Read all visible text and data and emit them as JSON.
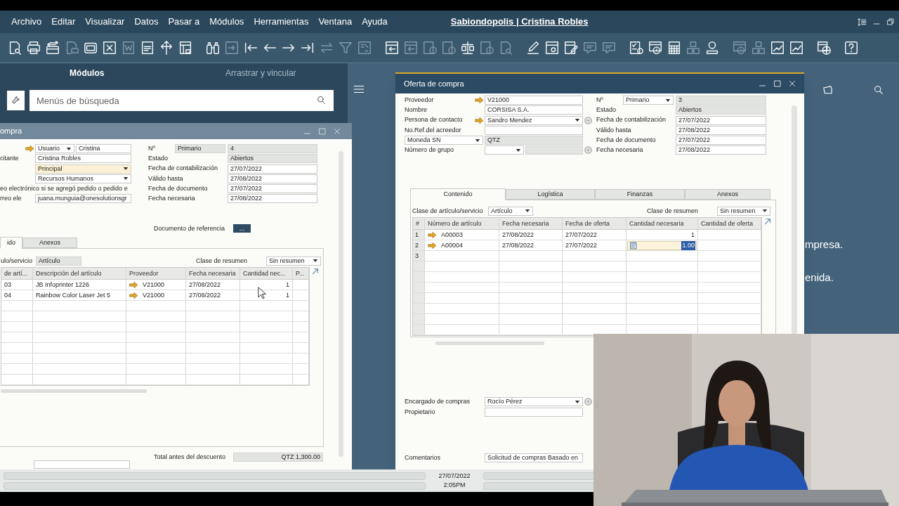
{
  "menu_bar": {
    "items": [
      "Archivo",
      "Editar",
      "Visualizar",
      "Datos",
      "Pasar a",
      "Módulos",
      "Herramientas",
      "Ventana",
      "Ayuda"
    ],
    "title": "Sabiondopolis | Cristina Robles"
  },
  "toolbar": {
    "groups": [
      {
        "buttons": [
          {
            "kind": "doc-search",
            "disabled": false
          },
          {
            "kind": "printer",
            "disabled": false
          },
          {
            "kind": "card",
            "disabled": false
          },
          {
            "kind": "doc-chat",
            "disabled": true
          },
          {
            "kind": "windows",
            "disabled": false
          },
          {
            "kind": "x-box",
            "disabled": false
          },
          {
            "kind": "word-doc",
            "disabled": true
          },
          {
            "kind": "pdf-doc",
            "disabled": false
          },
          {
            "kind": "move",
            "disabled": false
          },
          {
            "kind": "doc-lock",
            "disabled": false
          }
        ]
      },
      {
        "buttons": [
          {
            "kind": "binoculars",
            "disabled": false
          },
          {
            "kind": "import",
            "disabled": true
          },
          {
            "kind": "first",
            "disabled": false
          },
          {
            "kind": "prev",
            "disabled": false
          },
          {
            "kind": "next",
            "disabled": false
          },
          {
            "kind": "last",
            "disabled": false
          },
          {
            "kind": "swap",
            "disabled": true
          },
          {
            "kind": "filter",
            "disabled": true
          },
          {
            "kind": "sort",
            "disabled": true
          }
        ]
      },
      {
        "buttons": [
          {
            "kind": "doc-arrow",
            "disabled": false
          },
          {
            "kind": "doc-arrow",
            "disabled": true
          },
          {
            "kind": "doc-coin",
            "disabled": true
          },
          {
            "kind": "doc-coin",
            "disabled": true
          },
          {
            "kind": "scale",
            "disabled": false
          },
          {
            "kind": "doc-coin",
            "disabled": true
          },
          {
            "kind": "doc-search",
            "disabled": true
          }
        ]
      },
      {
        "buttons": [
          {
            "kind": "pencil",
            "disabled": false
          },
          {
            "kind": "gear-window",
            "disabled": false
          },
          {
            "kind": "pencil-doc",
            "disabled": false
          },
          {
            "kind": "chat",
            "disabled": true
          },
          {
            "kind": "chat",
            "disabled": true
          }
        ]
      },
      {
        "buttons": [
          {
            "kind": "checklist",
            "disabled": false
          },
          {
            "kind": "alert-window",
            "disabled": false
          },
          {
            "kind": "calculator",
            "disabled": false
          },
          {
            "kind": "boxes",
            "disabled": true
          },
          {
            "kind": "user",
            "disabled": false
          }
        ]
      },
      {
        "buttons": [
          {
            "kind": "alert-window",
            "disabled": true
          },
          {
            "kind": "boxes",
            "disabled": true
          },
          {
            "kind": "chart",
            "disabled": false
          },
          {
            "kind": "chart",
            "disabled": false
          }
        ]
      },
      {
        "buttons": [
          {
            "kind": "globe",
            "disabled": false
          }
        ]
      },
      {
        "buttons": [
          {
            "kind": "help",
            "disabled": false
          }
        ]
      }
    ]
  },
  "left_panel": {
    "tabs": [
      {
        "label": "Módulos",
        "selected": true
      },
      {
        "label": "Arrastrar y vincular",
        "selected": false
      }
    ],
    "search": {
      "placeholder": "Menús de búsqueda"
    }
  },
  "desktop_notes": [
    "mpresa.",
    "enida."
  ],
  "request_window": {
    "title": "ompra",
    "left_rows": [
      {
        "kind": "field",
        "link": true,
        "fields": [
          {
            "value": "Usuario",
            "dropdown": true,
            "readonly": false,
            "highlight": false
          },
          {
            "value": "Cristina",
            "dropdown": false,
            "readonly": false,
            "highlight": false
          }
        ]
      },
      {
        "kind": "field",
        "label": "citante",
        "link": false,
        "fields": [
          {
            "value": "Cristina Robles",
            "dropdown": false,
            "readonly": false,
            "highlight": false
          }
        ]
      },
      {
        "kind": "field",
        "link": false,
        "fields": [
          {
            "value": "Principal",
            "dropdown": true,
            "readonly": false,
            "highlight": true
          }
        ]
      },
      {
        "kind": "field",
        "link": false,
        "fields": [
          {
            "value": "Recursos Humanos",
            "dropdown": true,
            "readonly": false,
            "highlight": false
          }
        ]
      },
      {
        "kind": "wide_label",
        "label": "eo electrónico si se agregó pedido o pedido e",
        "link": false
      },
      {
        "kind": "field",
        "label": "rreo ele",
        "link": false,
        "fields": [
          {
            "value": "juana.munguia@onesolutionsgr",
            "dropdown": false,
            "readonly": false,
            "highlight": false
          }
        ]
      }
    ],
    "right_rows": [
      {
        "kind": "split",
        "label": "Nº",
        "fields": [
          {
            "value": "Primario",
            "dropdown": false,
            "readonly": true,
            "highlight": false
          },
          {
            "value": "4",
            "dropdown": false,
            "readonly": true,
            "highlight": false
          }
        ]
      },
      {
        "kind": "field",
        "label": "Estado",
        "fields": [
          {
            "value": "Abiertos",
            "dropdown": false,
            "readonly": true,
            "highlight": false
          }
        ]
      },
      {
        "kind": "field",
        "label": "Fecha de contabilización",
        "fields": [
          {
            "value": "27/07/2022",
            "dropdown": false,
            "readonly": false,
            "highlight": false
          }
        ]
      },
      {
        "kind": "field",
        "label": "Válido hasta",
        "fields": [
          {
            "value": "27/08/2022",
            "dropdown": false,
            "readonly": false,
            "highlight": false
          }
        ]
      },
      {
        "kind": "field",
        "label": "Fecha de documento",
        "fields": [
          {
            "value": "27/07/2022",
            "dropdown": false,
            "readonly": false,
            "highlight": false
          }
        ]
      },
      {
        "kind": "field",
        "label": "Fecha necesaria",
        "fields": [
          {
            "value": "27/08/2022",
            "dropdown": false,
            "readonly": false,
            "highlight": false
          }
        ]
      }
    ],
    "reference": {
      "label": "Documento de referencia",
      "button": "..."
    },
    "tabs": [
      {
        "label": "ido",
        "selected": true
      },
      {
        "label": "Anexos",
        "selected": false
      }
    ],
    "item_type": {
      "label": "ulo/servicio",
      "field": {
        "value": "Artículo",
        "dropdown": false,
        "readonly": true,
        "highlight": false
      }
    },
    "summary": {
      "label": "Clase de resumen",
      "field": {
        "value": "Sin resumen",
        "dropdown": true,
        "readonly": false,
        "highlight": false
      }
    },
    "grid": {
      "columns": [
        {
          "header": "de artí...",
          "kind": "text"
        },
        {
          "header": "Descripción del artículo",
          "kind": "text"
        },
        {
          "header": "Proveedor",
          "kind": "link"
        },
        {
          "header": "Fecha necesaria",
          "kind": "text"
        },
        {
          "header": "Cantidad nec...",
          "kind": "number"
        },
        {
          "header": "P...",
          "kind": "text"
        }
      ],
      "rows": [
        {
          "cells": [
            "03",
            "JB Infoprinter 1226",
            "V21000",
            "27/08/2022",
            "1"
          ],
          "editing": false
        },
        {
          "cells": [
            "04",
            "Rainbow Color Laser Jet 5",
            "V21000",
            "27/08/2022",
            "1"
          ],
          "editing": false
        }
      ]
    },
    "total": {
      "label": "Total antes del descuento",
      "value": "QTZ 1,300.00"
    }
  },
  "offer_window": {
    "title": "Oferta de compra",
    "left_rows": [
      {
        "kind": "field",
        "label": "Proveedor",
        "link": true,
        "detail": false,
        "fields": [
          {
            "value": "V21000",
            "dropdown": false,
            "readonly": false,
            "highlight": false
          }
        ]
      },
      {
        "kind": "field",
        "label": "Nombre",
        "link": false,
        "detail": false,
        "fields": [
          {
            "value": "CORSISA S.A.",
            "dropdown": false,
            "readonly": false,
            "highlight": false
          }
        ]
      },
      {
        "kind": "field",
        "label": "Persona de contacto",
        "link": true,
        "detail": true,
        "fields": [
          {
            "value": "Sandro Mendez",
            "dropdown": true,
            "readonly": false,
            "highlight": false
          }
        ]
      },
      {
        "kind": "field",
        "label": "No.Ref.del acreedor",
        "link": false,
        "detail": false,
        "fields": [
          {
            "dropdown": false,
            "readonly": false,
            "highlight": false
          }
        ]
      },
      {
        "kind": "select_label",
        "label": "Moneda SN",
        "link": false,
        "detail": false,
        "fields": [
          {
            "value": "QTZ",
            "dropdown": false,
            "readonly": true,
            "highlight": false
          }
        ]
      },
      {
        "kind": "field",
        "label": "Número de grupo",
        "link": false,
        "detail": true,
        "fields": [
          {
            "dropdown": true,
            "readonly": false,
            "highlight": false
          },
          {
            "dropdown": false,
            "readonly": true,
            "highlight": false
          }
        ]
      }
    ],
    "right_rows": [
      {
        "kind": "split",
        "label": "Nº",
        "fields": [
          {
            "value": "Primario",
            "dropdown": true,
            "readonly": false,
            "highlight": false
          },
          {
            "value": "3",
            "dropdown": false,
            "readonly": true,
            "highlight": false
          }
        ]
      },
      {
        "kind": "field",
        "label": "Estado",
        "fields": [
          {
            "value": "Abiertos",
            "dropdown": false,
            "readonly": true,
            "highlight": false
          }
        ]
      },
      {
        "kind": "field",
        "label": "Fecha de contabilización",
        "fields": [
          {
            "value": "27/07/2022",
            "dropdown": false,
            "readonly": false,
            "highlight": false
          }
        ]
      },
      {
        "kind": "field",
        "label": "Válido hasta",
        "fields": [
          {
            "value": "27/08/2022",
            "dropdown": false,
            "readonly": false,
            "highlight": false
          }
        ]
      },
      {
        "kind": "field",
        "label": "Fecha de documento",
        "fields": [
          {
            "value": "27/07/2022",
            "dropdown": false,
            "readonly": false,
            "highlight": false
          }
        ]
      },
      {
        "kind": "field",
        "label": "Fecha necesaria",
        "fields": [
          {
            "value": "27/08/2022",
            "dropdown": false,
            "readonly": false,
            "highlight": false
          }
        ]
      }
    ],
    "tabs": [
      {
        "label": "Contenido",
        "selected": true
      },
      {
        "label": "Logística",
        "selected": false
      },
      {
        "label": "Finanzas",
        "selected": false
      },
      {
        "label": "Anexos",
        "selected": false
      }
    ],
    "item_type": {
      "label": "Clase de artículo/servicio",
      "field": {
        "value": "Artículo",
        "dropdown": true,
        "readonly": false,
        "highlight": false
      }
    },
    "summary": {
      "label": "Clase de resumen",
      "field": {
        "value": "Sin resumen",
        "dropdown": true,
        "readonly": false,
        "highlight": false
      }
    },
    "grid": {
      "columns": [
        {
          "header": "#",
          "kind": "rownum"
        },
        {
          "header": "Número de artículo",
          "kind": "link"
        },
        {
          "header": "Fecha necesaria",
          "kind": "text"
        },
        {
          "header": "Fecha de oferta",
          "kind": "text"
        },
        {
          "header": "Cantidad necesaria",
          "kind": "number"
        },
        {
          "header": "Cantidad de oferta",
          "kind": "number"
        }
      ],
      "rows": [
        {
          "cells": [
            "1",
            "A00003",
            "27/08/2022",
            "27/07/2022",
            "1"
          ],
          "editing": false
        },
        {
          "cells": [
            "2",
            "A00004",
            "27/08/2022",
            "27/07/2022",
            "1.00"
          ],
          "editing": true
        },
        {
          "cells": [
            "3"
          ],
          "editing": false
        }
      ]
    },
    "footer_rows": [
      {
        "kind": "field",
        "label": "Encargado de compras",
        "link": false,
        "detail": true,
        "fields": [
          {
            "value": "Rocío Pérez",
            "dropdown": true,
            "readonly": false,
            "highlight": false
          }
        ]
      },
      {
        "kind": "field",
        "label": "Propietario",
        "link": false,
        "detail": false,
        "fields": [
          {
            "dropdown": false,
            "readonly": false,
            "highlight": false
          }
        ]
      },
      {
        "kind": "field",
        "label": "Comentarios",
        "link": false,
        "detail": false,
        "fields": [
          {
            "value": "Solicitud de compras Basado en",
            "dropdown": false,
            "readonly": false,
            "highlight": false
          }
        ]
      }
    ]
  },
  "status_bar": {
    "date": "27/07/2022",
    "time": "2:05PM"
  }
}
